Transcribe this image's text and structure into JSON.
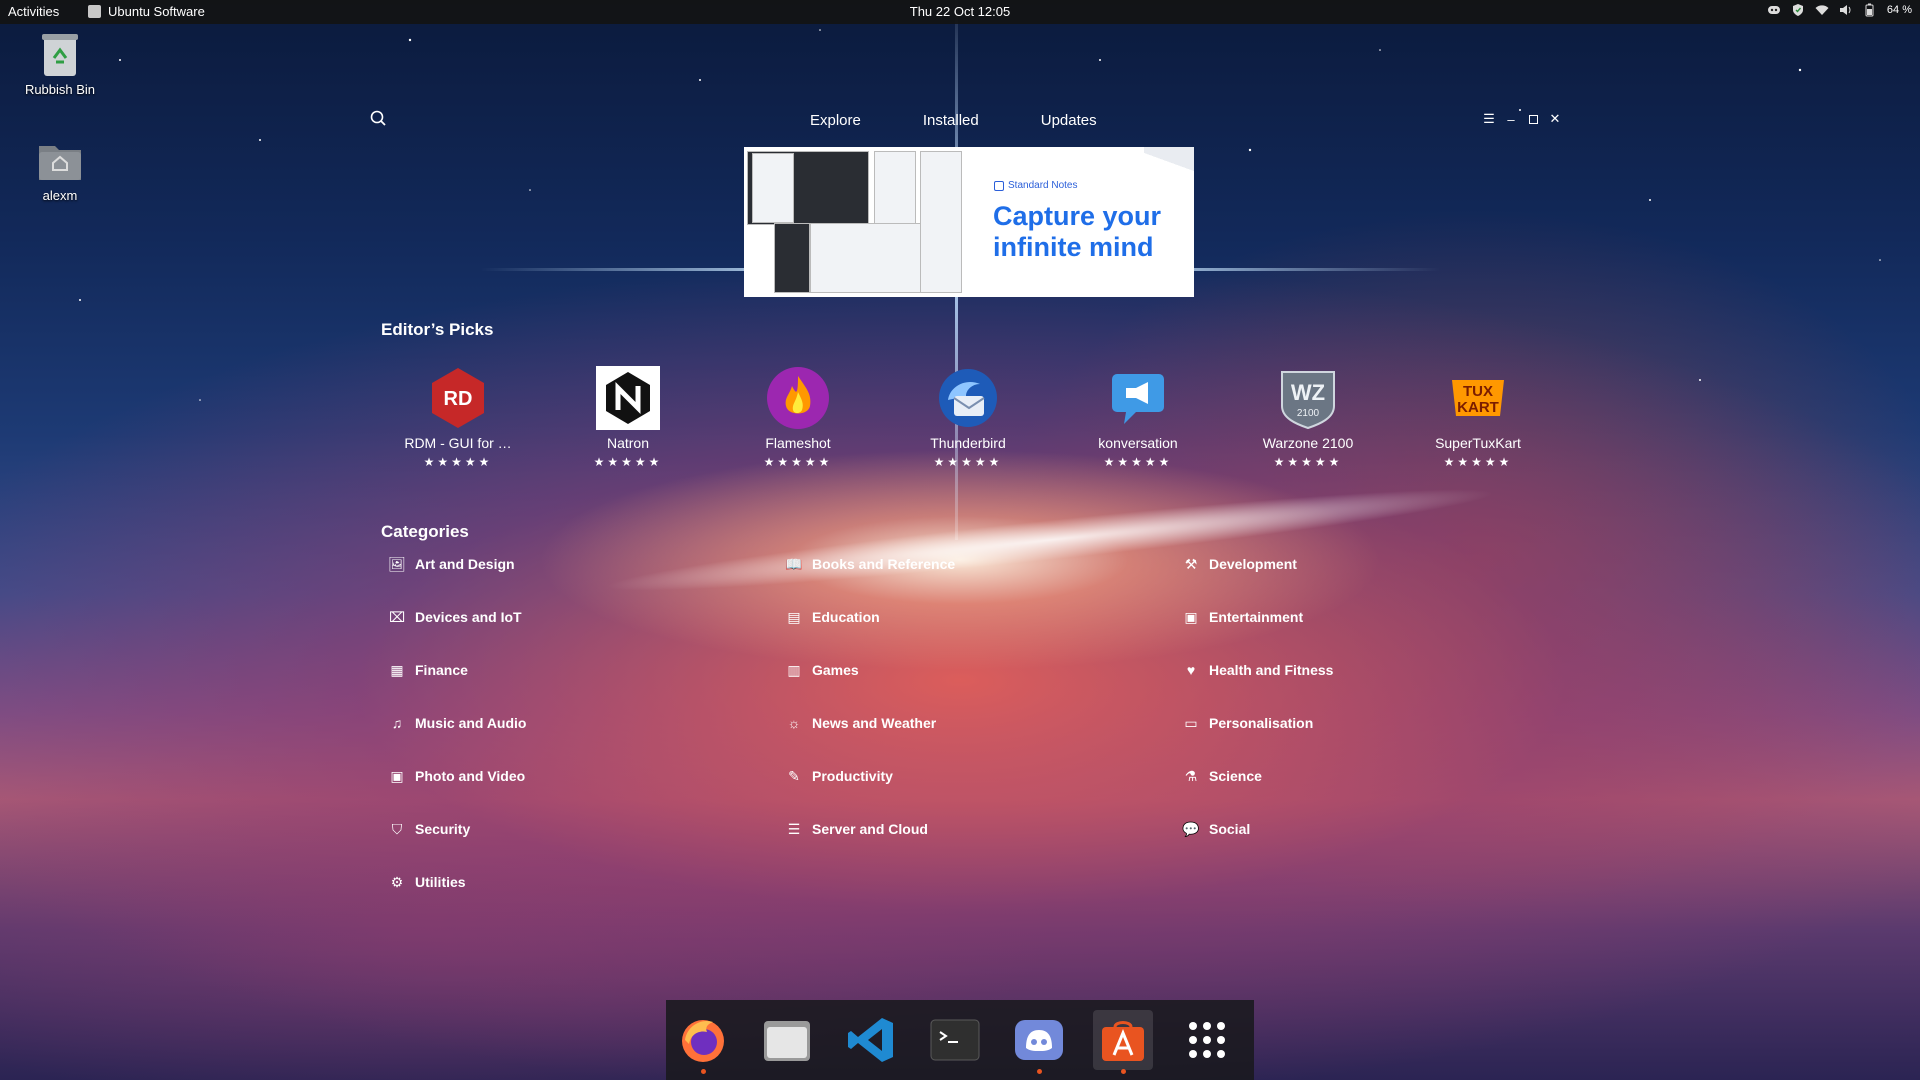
{
  "topbar": {
    "activities": "Activities",
    "app_name": "Ubuntu Software",
    "clock": "Thu 22 Oct  12:05",
    "battery": "64 %"
  },
  "desktop": {
    "trash_label": "Rubbish Bin",
    "home_label": "alexm"
  },
  "window": {
    "tabs": [
      "Explore",
      "Installed",
      "Updates"
    ],
    "banner": {
      "brand": "Standard Notes",
      "headline": "Capture your infinite mind"
    },
    "editors_picks_title": "Editor’s Picks",
    "editors_picks": [
      {
        "name": "RDM - GUI for …",
        "stars": "★★★★★",
        "icon": "rdm-icon"
      },
      {
        "name": "Natron",
        "stars": "★★★★★",
        "icon": "natron-icon"
      },
      {
        "name": "Flameshot",
        "stars": "★★★★★",
        "icon": "flameshot-icon"
      },
      {
        "name": "Thunderbird",
        "stars": "★★★★★",
        "icon": "thunderbird-icon"
      },
      {
        "name": "konversation",
        "stars": "★★★★★",
        "icon": "konversation-icon"
      },
      {
        "name": "Warzone 2100",
        "stars": "★★★★★",
        "icon": "warzone-icon"
      },
      {
        "name": "SuperTuxKart",
        "stars": "★★★★★",
        "icon": "supertuxkart-icon"
      }
    ],
    "categories_title": "Categories",
    "categories": [
      [
        "Art and Design",
        "Books and Reference",
        "Development"
      ],
      [
        "Devices and IoT",
        "Education",
        "Entertainment"
      ],
      [
        "Finance",
        "Games",
        "Health and Fitness"
      ],
      [
        "Music and Audio",
        "News and Weather",
        "Personalisation"
      ],
      [
        "Photo and Video",
        "Productivity",
        "Science"
      ],
      [
        "Security",
        "Server and Cloud",
        "Social"
      ],
      [
        "Utilities"
      ]
    ]
  },
  "dock": {
    "items": [
      "firefox-icon",
      "files-icon",
      "vscode-icon",
      "terminal-icon",
      "discord-icon",
      "ubuntu-software-icon",
      "show-apps-icon"
    ],
    "accent": "#e95420"
  }
}
